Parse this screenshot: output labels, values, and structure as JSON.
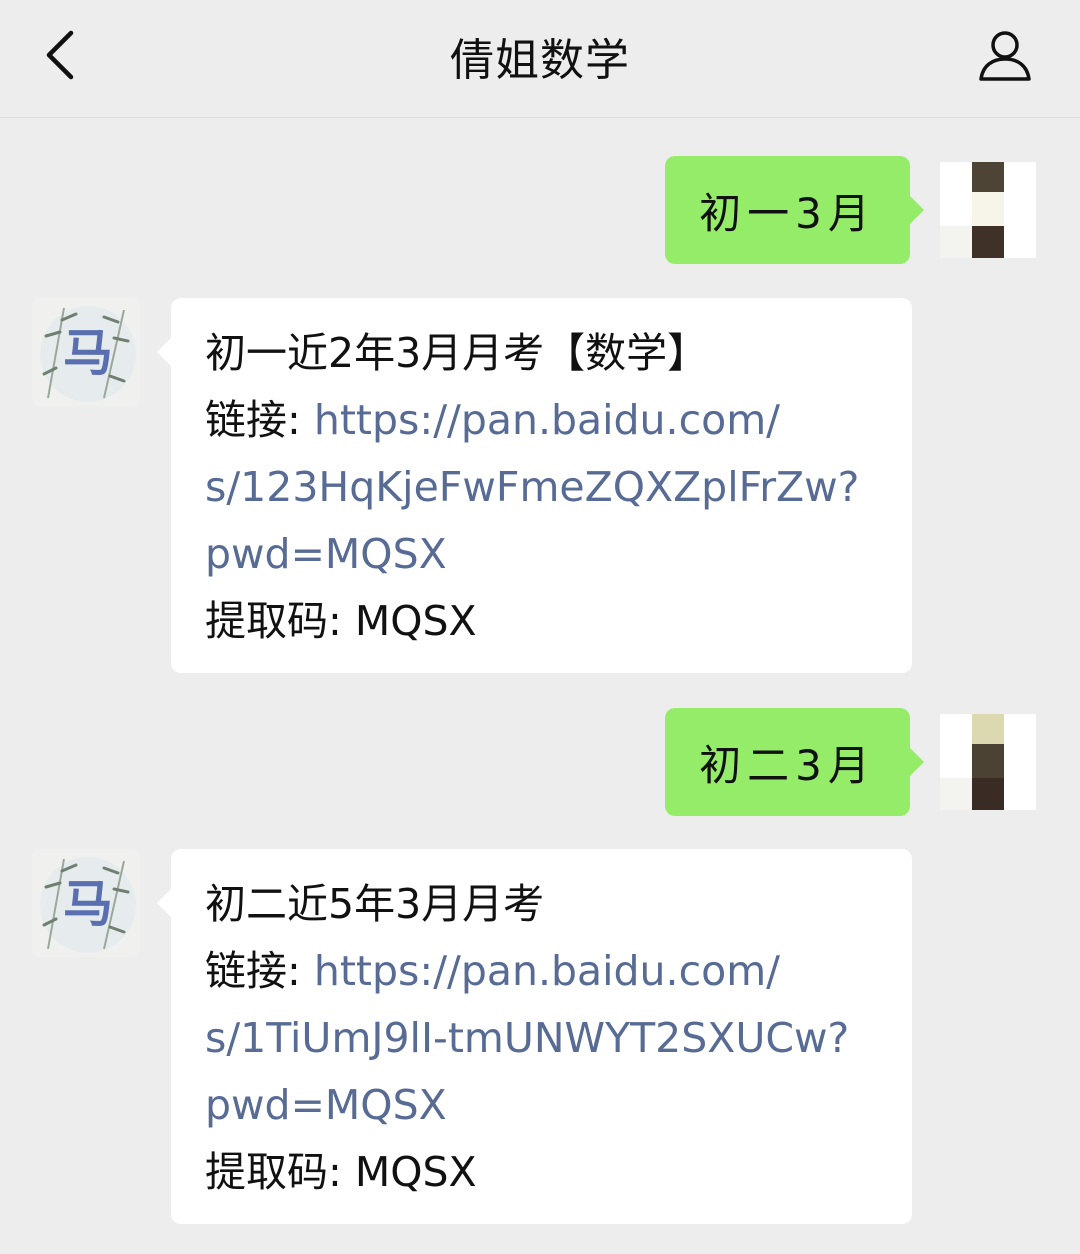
{
  "header": {
    "title": "倩姐数学",
    "back_icon": "chevron-left-icon",
    "profile_icon": "person-icon"
  },
  "messages": [
    {
      "from": "self",
      "text": "初一3月"
    },
    {
      "from": "contact",
      "title": "初一近2年3月月考【数学】",
      "link_label": "链接: ",
      "link_url_lines": [
        "https://pan.baidu.com/",
        "s/123HqKjeFwFmeZQXZplFrZw?",
        "pwd=MQSX"
      ],
      "code_label": "提取码: MQSX"
    },
    {
      "from": "self",
      "text": "初二3月"
    },
    {
      "from": "contact",
      "title": "初二近5年3月月考",
      "link_label": "链接: ",
      "link_url_lines": [
        "https://pan.baidu.com/",
        "s/1TiUmJ9lI-tmUNWYT2SXUCw?",
        "pwd=MQSX"
      ],
      "code_label": "提取码: MQSX"
    }
  ],
  "avatars": {
    "contact_glyph": "马"
  },
  "colors": {
    "background": "#ededed",
    "sent_bubble": "#95ec69",
    "received_bubble": "#ffffff",
    "link": "#576b95",
    "contact_glyph": "#5a6fb0"
  }
}
